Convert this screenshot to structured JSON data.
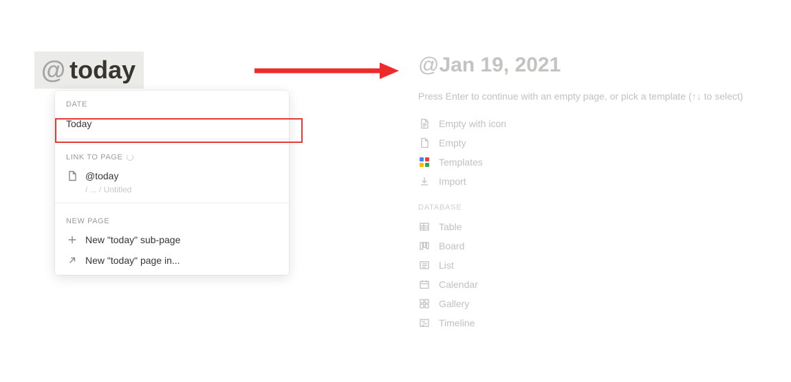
{
  "left": {
    "at_symbol": "@",
    "typed_text": "today"
  },
  "menu": {
    "date_label": "DATE",
    "today_label": "Today",
    "link_label": "LINK TO PAGE",
    "link_item_text": "@today",
    "link_item_path": " / ... / Untitled",
    "newpage_label": "NEW PAGE",
    "new_subpage_text": "New \"today\" sub-page",
    "new_pagein_text": "New \"today\" page in..."
  },
  "right": {
    "title_at": "@",
    "title_date": "Jan 19, 2021",
    "hint": "Press Enter to continue with an empty page, or pick a template (↑↓ to select)",
    "options": {
      "empty_icon": "Empty with icon",
      "empty": "Empty",
      "templates": "Templates",
      "import": "Import"
    },
    "database_label": "DATABASE",
    "database": {
      "table": "Table",
      "board": "Board",
      "list": "List",
      "calendar": "Calendar",
      "gallery": "Gallery",
      "timeline": "Timeline"
    }
  }
}
